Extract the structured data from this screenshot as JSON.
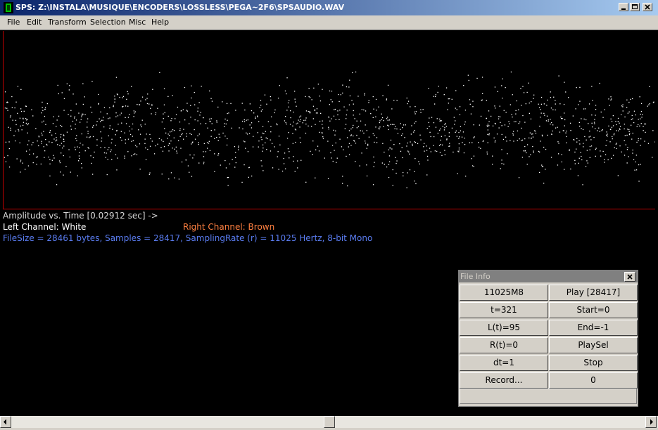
{
  "window": {
    "title": "SPS: Z:\\INSTALA\\MUSIQUE\\ENCODERS\\LOSSLESS\\PEGA~2F6\\SPSAUDIO.WAV"
  },
  "menu": [
    "File",
    "Edit",
    "Transform",
    "Selection",
    "Misc",
    "Help"
  ],
  "plot": {
    "caption": "Amplitude vs. Time [0.02912 sec] ->",
    "left_channel": "Left Channel: White",
    "right_channel": "Right Channel: Brown",
    "file_summary": "FileSize = 28461 bytes, Samples = 28417, SamplingRate (r) = 11025 Hertz, 8-bit Mono",
    "colors": {
      "background": "#000000",
      "samples": "#ffffff",
      "axis": "#c00000",
      "left_label": "#ffffff",
      "right_label": "#ff8040",
      "summary": "#5a7cf0"
    }
  },
  "file_info": {
    "title": "File Info",
    "buttons": [
      [
        "11025M8",
        "Play [28417]"
      ],
      [
        "t=321",
        "Start=0"
      ],
      [
        "L(t)=95",
        "End=-1"
      ],
      [
        "R(t)=0",
        "PlaySel"
      ],
      [
        "dt=1",
        "Stop"
      ],
      [
        "Record...",
        "0"
      ]
    ],
    "status": ""
  }
}
